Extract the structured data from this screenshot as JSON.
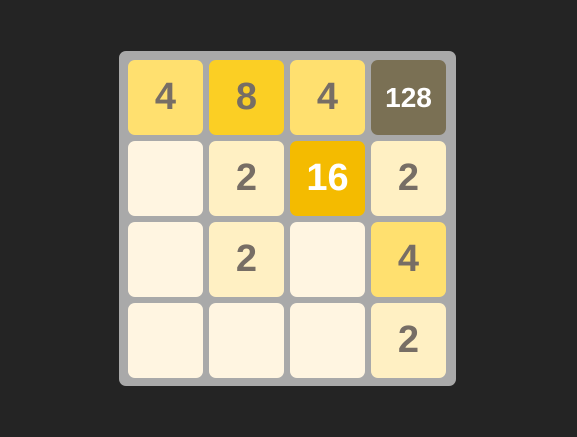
{
  "board": {
    "size": 4,
    "tiles": [
      [
        4,
        8,
        4,
        128
      ],
      [
        0,
        2,
        16,
        2
      ],
      [
        0,
        2,
        0,
        4
      ],
      [
        0,
        0,
        0,
        2
      ]
    ]
  },
  "colors": {
    "page_background": "#242424",
    "board_background": "#a9a9a9",
    "empty": "#fff5e1",
    "tile_2": "#fff0c3",
    "tile_4": "#ffe06f",
    "tile_8": "#fbcf24",
    "tile_16": "#f4bb00",
    "tile_128": "#7a7054",
    "dark_text": "#776e65",
    "light_text": "#ffffff"
  }
}
